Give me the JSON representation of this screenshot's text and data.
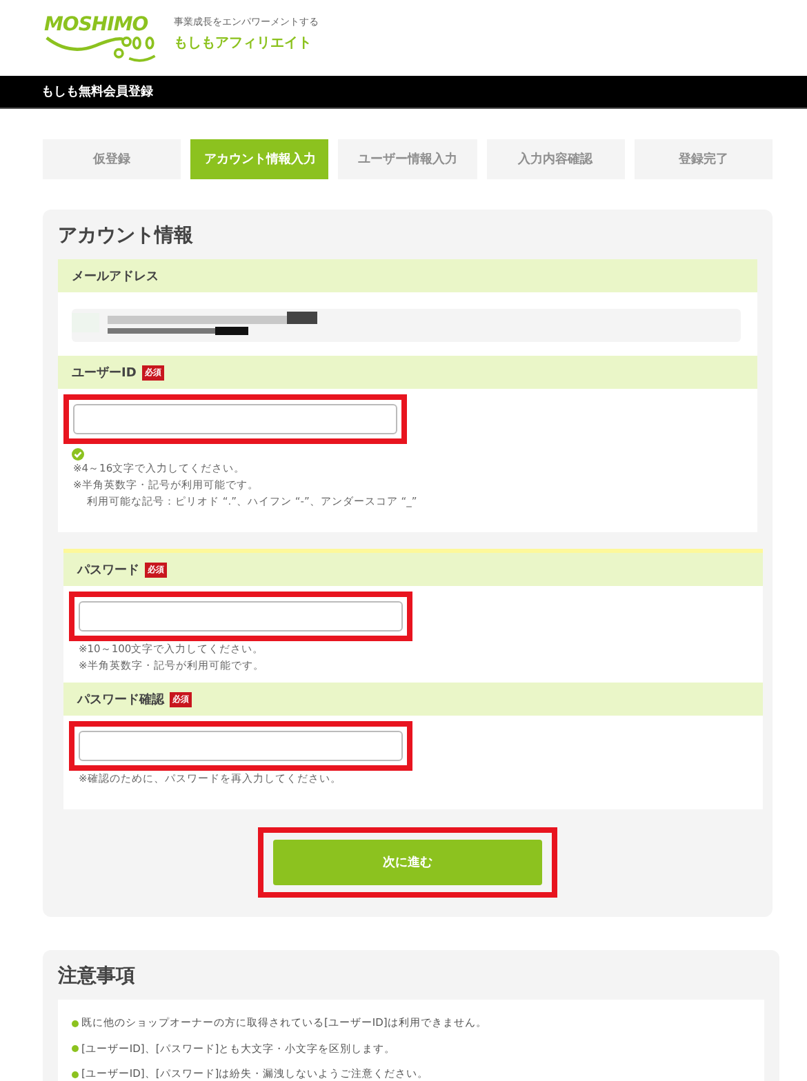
{
  "header": {
    "logo_text": "MOSHIMO",
    "tagline": "事業成長をエンパワーメントする",
    "brand": "もしもアフィリエイト"
  },
  "title_bar": "もしも無料会員登録",
  "steps": [
    {
      "label": "仮登録",
      "selected": false
    },
    {
      "label": "アカウント情報入力",
      "selected": true
    },
    {
      "label": "ユーザー情報入力",
      "selected": false
    },
    {
      "label": "入力内容確認",
      "selected": false
    },
    {
      "label": "登録完了",
      "selected": false
    }
  ],
  "account": {
    "title": "アカウント情報",
    "groups": [
      {
        "fields": [
          {
            "kind": "readonly",
            "label": "メールアドレス"
          },
          {
            "kind": "input",
            "label": "ユーザーID",
            "badge": "必須",
            "highlighted": true,
            "valid": true,
            "notes": [
              "※4～16文字で入力してください。",
              "※半角英数字・記号が利用可能です。"
            ],
            "sub_note": "利用可能な記号：ピリオド “.”、ハイフン “-”、アンダースコア “_”"
          }
        ]
      },
      {
        "fields": [
          {
            "kind": "input",
            "label": "パスワード",
            "badge": "必須",
            "highlighted": true,
            "notes": [
              "※10～100文字で入力してください。",
              "※半角英数字・記号が利用可能です。"
            ]
          },
          {
            "kind": "input",
            "label": "パスワード確認",
            "badge": "必須",
            "highlighted": true,
            "notes": [
              "※確認のために、パスワードを再入力してください。"
            ]
          }
        ]
      }
    ]
  },
  "next_button": {
    "label": "次に進む",
    "highlighted": true
  },
  "notice": {
    "title": "注意事項",
    "items": [
      "既に他のショップオーナーの方に取得されている[ユーザーID]は利用できません。",
      "[ユーザーID]、[パスワード]とも大文字・小文字を区別します。",
      "[ユーザーID]、[パスワード]は紛失・漏洩しないようご注意ください。"
    ]
  }
}
